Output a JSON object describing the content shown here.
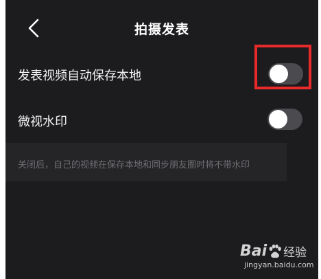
{
  "header": {
    "title": "拍摄发表",
    "back_icon": "chevron-left-icon"
  },
  "settings": [
    {
      "label": "发表视频自动保存本地",
      "enabled": false,
      "highlighted": true
    },
    {
      "label": "微视水印",
      "enabled": false,
      "highlighted": false
    }
  ],
  "note": "关闭后，自己的视频在保存本地和同步朋友圈时将不带水印",
  "watermark": {
    "brand_left": "Bai",
    "brand_right": "经验",
    "url": "jingyan.baidu.com"
  },
  "colors": {
    "background": "#1c1c1f",
    "toggle_off": "#4b4b4f",
    "knob": "#ffffff",
    "highlight": "#e82a2a",
    "note_text": "#6e6e72"
  }
}
